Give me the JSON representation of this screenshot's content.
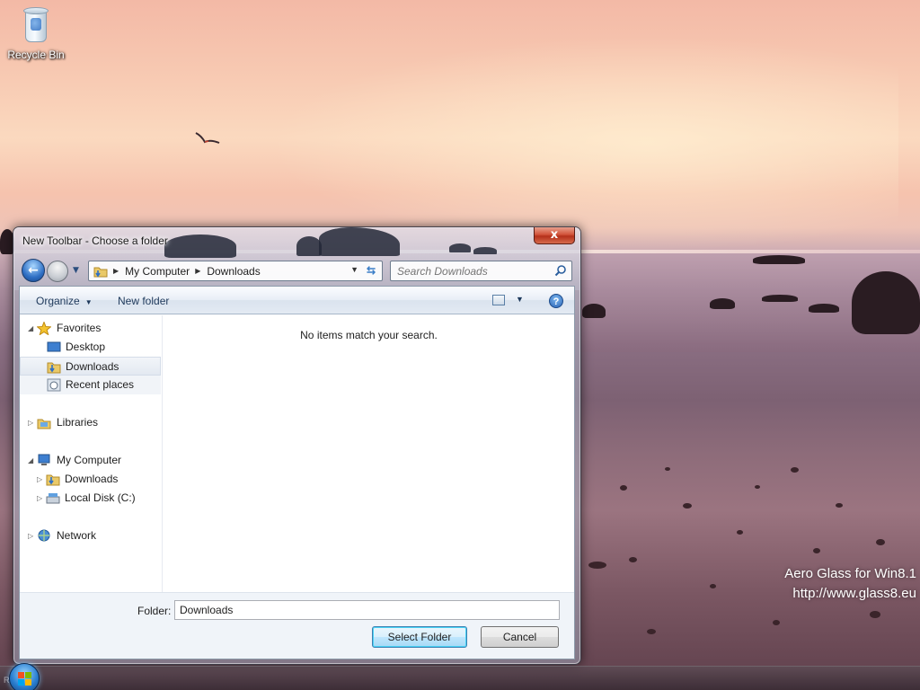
{
  "desktop": {
    "icons": [
      {
        "label": "Recycle Bin",
        "icon": "recycle-bin-icon"
      }
    ],
    "watermark": {
      "line1": "Aero Glass for Win8.1",
      "line2": "http://www.glass8.eu"
    },
    "taskbar_text": "RP ED"
  },
  "dialog": {
    "title": "New Toolbar - Choose a folder",
    "close_label": "x",
    "address": {
      "segments": [
        "My Computer",
        "Downloads"
      ]
    },
    "search": {
      "placeholder": "Search Downloads"
    },
    "toolbar": {
      "organize_label": "Organize",
      "new_folder_label": "New folder"
    },
    "nav_pane": {
      "favorites": {
        "label": "Favorites",
        "items": [
          "Desktop",
          "Downloads",
          "Recent places"
        ]
      },
      "libraries": {
        "label": "Libraries"
      },
      "my_computer": {
        "label": "My Computer",
        "items": [
          "Downloads",
          "Local Disk (C:)"
        ]
      },
      "network": {
        "label": "Network"
      }
    },
    "content": {
      "empty_message": "No items match your search."
    },
    "footer": {
      "folder_label": "Folder:",
      "folder_value": "Downloads",
      "select_label": "Select Folder",
      "cancel_label": "Cancel"
    }
  },
  "colors": {
    "accent": "#3c7fb1",
    "close_red": "#c9402a"
  }
}
